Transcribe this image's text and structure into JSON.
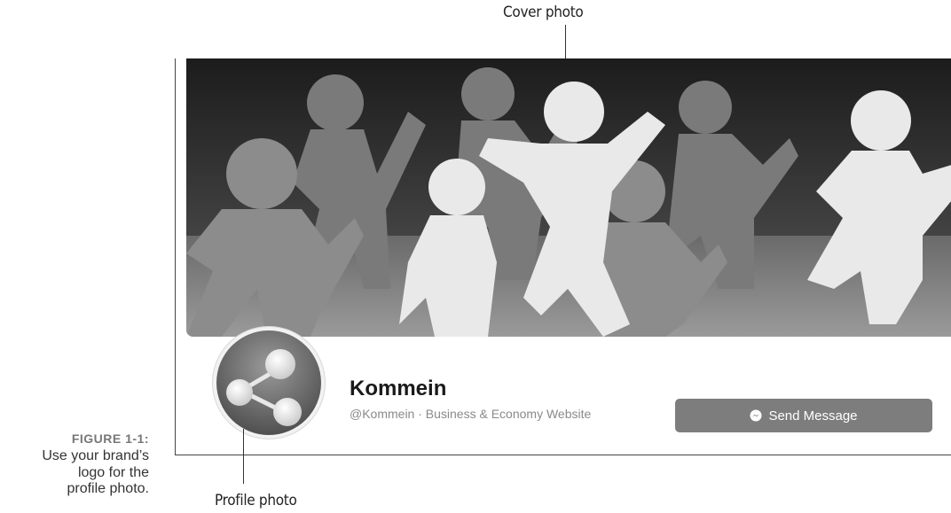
{
  "callouts": {
    "cover": "Cover photo",
    "profile": "Profile photo"
  },
  "figure": {
    "number": "FIGURE 1-1:",
    "caption_line1": "Use your brand’s",
    "caption_line2": "logo for the",
    "caption_line3": "profile photo."
  },
  "page": {
    "name": "Kommein",
    "handle": "@Kommein · Business & Economy Website",
    "send_message_label": "Send Message"
  },
  "icons": {
    "messenger": "messenger-icon",
    "logo": "molecule-logo-icon"
  }
}
